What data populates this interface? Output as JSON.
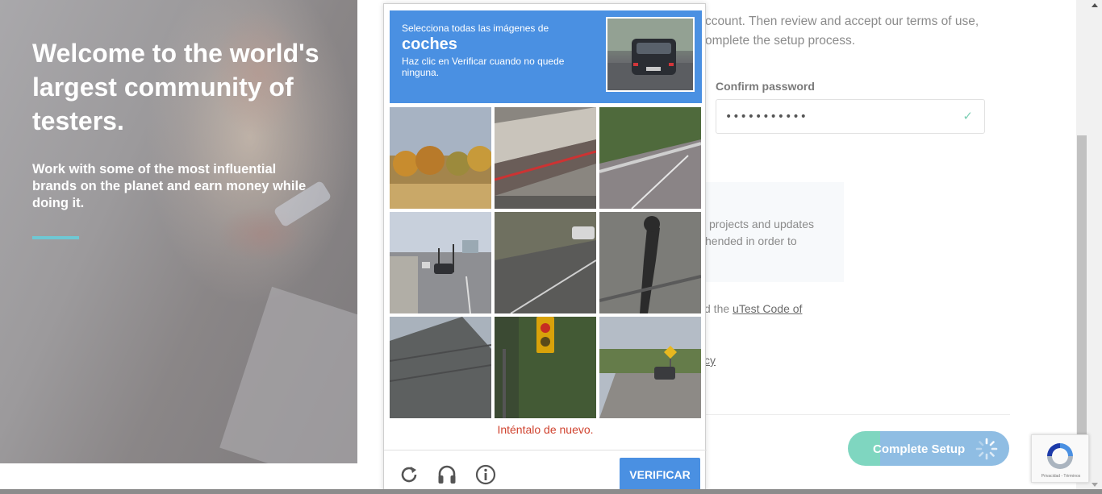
{
  "hero": {
    "title": "Welcome to the world's largest community of testers.",
    "subtitle": "Work with some of the most influential brands on the planet and earn money while doing it.",
    "accent_color": "#6fc8d4"
  },
  "form": {
    "intro_line1": "ccount. Then review and accept our terms of use,",
    "intro_line2": "omplete the setup process.",
    "confirm_password_label": "Confirm password",
    "confirm_password_value": "•••••••••••",
    "info_line1": "projects and updates",
    "info_line2": "hended in order to",
    "code_prefix": "d the ",
    "code_link": "uTest Code of",
    "policy_fragment": "cy",
    "complete_setup_label": "Complete Setup"
  },
  "captcha": {
    "instruction_line1": "Selecciona todas las imágenes de",
    "target_word": "coches",
    "instruction_line2": "Haz clic en Verificar cuando no quede ninguna.",
    "error_text": "Inténtalo de nuevo.",
    "verify_label": "VERIFICAR",
    "icons": [
      "reload-icon",
      "headphones-icon",
      "info-icon"
    ],
    "tiles": [
      "tile-autumn-trees",
      "tile-truck-trailer",
      "tile-guardrail-road",
      "tile-street-cars",
      "tile-road-car",
      "tile-shadow-road",
      "tile-house-roof",
      "tile-traffic-light",
      "tile-road-sign-car"
    ],
    "header_color": "#4a90e2",
    "error_color": "#d0432f"
  },
  "recaptcha_badge": {
    "text": "Privacidad - Términos"
  }
}
